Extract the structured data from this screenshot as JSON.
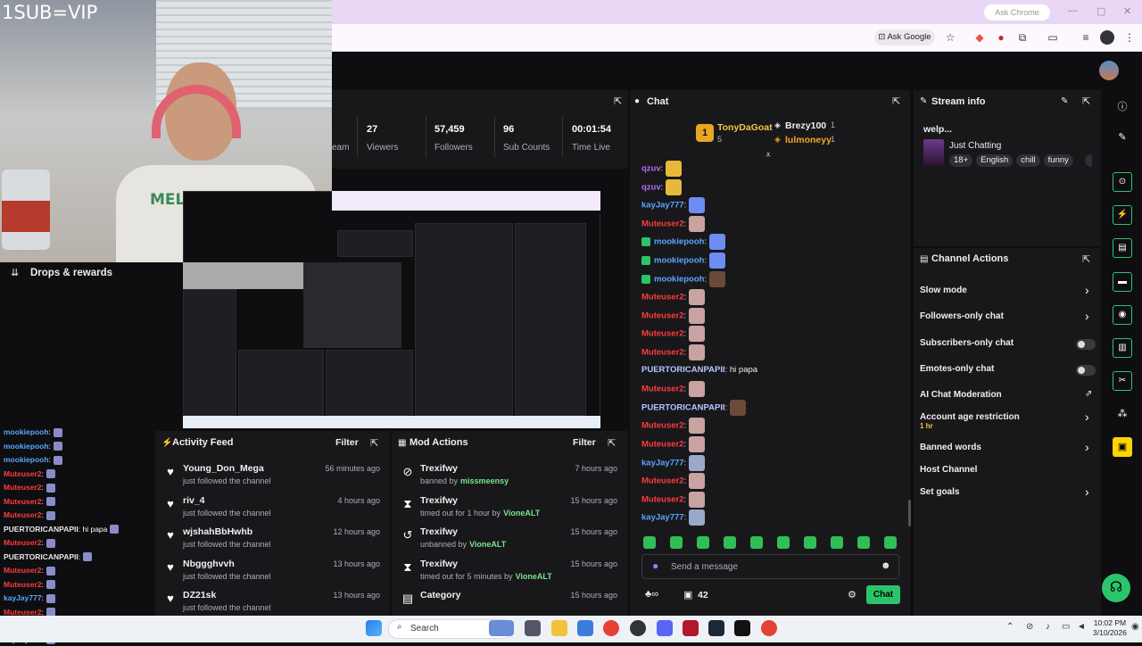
{
  "browser": {
    "ask_chrome": "Ask Chrome",
    "ask_google": "Ask Google",
    "ext_badge": "1"
  },
  "overlay": {
    "sub_vip": "1SUB=VIP",
    "shirt_text": "MELVINS"
  },
  "drops": {
    "title": "Drops & rewards"
  },
  "left_chat": [
    {
      "user": "mookiepooh",
      "color": "#5aa6ff",
      "text": ":"
    },
    {
      "user": "mookiepooh",
      "color": "#5aa6ff",
      "text": ":"
    },
    {
      "user": "mookiepooh",
      "color": "#5aa6ff",
      "text": ":"
    },
    {
      "user": "Muteuser2",
      "color": "#ff3b3b",
      "text": ":"
    },
    {
      "user": "Muteuser2",
      "color": "#ff3b3b",
      "text": ":"
    },
    {
      "user": "Muteuser2",
      "color": "#ff3b3b",
      "text": ":"
    },
    {
      "user": "Muteuser2",
      "color": "#ff3b3b",
      "text": ":"
    },
    {
      "user": "PUERTORICANPAPII",
      "color": "#e6e6e6",
      "text": ": hi papa"
    },
    {
      "user": "Muteuser2",
      "color": "#ff3b3b",
      "text": ":"
    },
    {
      "user": "PUERTORICANPAPII",
      "color": "#e6e6e6",
      "text": ":"
    },
    {
      "user": "Muteuser2",
      "color": "#ff3b3b",
      "text": ":"
    },
    {
      "user": "Muteuser2",
      "color": "#ff3b3b",
      "text": ":"
    },
    {
      "user": "kayJay777",
      "color": "#5aa6ff",
      "text": ":"
    },
    {
      "user": "Muteuser2",
      "color": "#ff3b3b",
      "text": ":"
    },
    {
      "user": "Muteuser2",
      "color": "#ff3b3b",
      "text": ":"
    },
    {
      "user": "kayJay777",
      "color": "#5aa6ff",
      "text": ":"
    }
  ],
  "stats": {
    "team_partial": "eam",
    "items": [
      {
        "value": "27",
        "label": "Viewers"
      },
      {
        "value": "57,459",
        "label": "Followers"
      },
      {
        "value": "96",
        "label": "Sub Counts"
      },
      {
        "value": "00:01:54",
        "label": "Time Live"
      }
    ]
  },
  "activity_feed": {
    "title": "Activity Feed",
    "filter": "Filter",
    "items": [
      {
        "name": "Young_Don_Mega",
        "desc": "just followed the channel",
        "time": "56 minutes ago",
        "icon": "heart-icon"
      },
      {
        "name": "riv_4",
        "desc": "just followed the channel",
        "time": "4 hours ago",
        "icon": "heart-icon"
      },
      {
        "name": "wjshahBbHwhb",
        "desc": "just followed the channel",
        "time": "12 hours ago",
        "icon": "heart-icon"
      },
      {
        "name": "Nbggghvvh",
        "desc": "just followed the channel",
        "time": "13 hours ago",
        "icon": "heart-icon"
      },
      {
        "name": "DZ21sk",
        "desc": "just followed the channel",
        "time": "13 hours ago",
        "icon": "heart-icon"
      }
    ]
  },
  "mod_actions": {
    "title": "Mod Actions",
    "filter": "Filter",
    "items": [
      {
        "name": "Trexifwy",
        "action": "banned by",
        "by": "missmeensy",
        "time": "7 hours ago",
        "icon": "ban-icon"
      },
      {
        "name": "Trexifwy",
        "action": "timed out for 1 hour by",
        "by": "VioneALT",
        "time": "15 hours ago",
        "icon": "hourglass-icon"
      },
      {
        "name": "Trexifwy",
        "action": "unbanned by",
        "by": "VioneALT",
        "time": "15 hours ago",
        "icon": "undo-icon"
      },
      {
        "name": "Trexifwy",
        "action": "timed out for 5 minutes by",
        "by": "VioneALT",
        "time": "15 hours ago",
        "icon": "hourglass-icon"
      },
      {
        "name": "Category",
        "action": "",
        "by": "",
        "time": "15 hours ago",
        "icon": "category-icon"
      }
    ]
  },
  "chat": {
    "title": "Chat",
    "leaderboard": {
      "first": {
        "rank": "1",
        "name": "TonyDaGoat",
        "count": "5"
      },
      "others": [
        {
          "name": "Brezy100",
          "count": "1"
        },
        {
          "name": "lulmoneyy",
          "count": "1"
        }
      ]
    },
    "messages": [
      {
        "user": "qzuv",
        "color": "#b76cf0",
        "text": ":"
      },
      {
        "user": "qzuv",
        "color": "#b76cf0",
        "text": ":"
      },
      {
        "user": "kayJay777",
        "color": "#5aa6ff",
        "text": ":"
      },
      {
        "user": "Muteuser2",
        "color": "#ff3b3b",
        "text": ":"
      },
      {
        "user": "mookiepooh",
        "color": "#5aa6ff",
        "text": ":"
      },
      {
        "user": "mookiepooh",
        "color": "#5aa6ff",
        "text": ":"
      },
      {
        "user": "mookiepooh",
        "color": "#5aa6ff",
        "text": ":"
      },
      {
        "user": "Muteuser2",
        "color": "#ff3b3b",
        "text": ":"
      },
      {
        "user": "Muteuser2",
        "color": "#ff3b3b",
        "text": ":"
      },
      {
        "user": "Muteuser2",
        "color": "#ff3b3b",
        "text": ":"
      },
      {
        "user": "Muteuser2",
        "color": "#ff3b3b",
        "text": ":"
      },
      {
        "user": "PUERTORICANPAPII",
        "color": "#b9c6ff",
        "text": ": hi papa"
      },
      {
        "user": "Muteuser2",
        "color": "#ff3b3b",
        "text": ":"
      },
      {
        "user": "PUERTORICANPAPII",
        "color": "#b9c6ff",
        "text": ":"
      },
      {
        "user": "Muteuser2",
        "color": "#ff3b3b",
        "text": ":"
      },
      {
        "user": "Muteuser2",
        "color": "#ff3b3b",
        "text": ":"
      },
      {
        "user": "kayJay777",
        "color": "#5aa6ff",
        "text": ":"
      },
      {
        "user": "Muteuser2",
        "color": "#ff3b3b",
        "text": ":"
      },
      {
        "user": "Muteuser2",
        "color": "#ff3b3b",
        "text": ":"
      },
      {
        "user": "kayJay777",
        "color": "#5aa6ff",
        "text": ":"
      }
    ],
    "placeholder": "Send a message",
    "points": "42",
    "send_label": "Chat"
  },
  "stream_info": {
    "title": "Stream info",
    "stream_title": "welp...",
    "category": "Just Chatting",
    "tags": [
      "18+",
      "English",
      "chill",
      "funny"
    ]
  },
  "channel_actions": {
    "title": "Channel Actions",
    "items": [
      {
        "label": "Slow mode",
        "control": "chevron"
      },
      {
        "label": "Followers-only chat",
        "control": "chevron"
      },
      {
        "label": "Subscribers-only chat",
        "control": "toggle"
      },
      {
        "label": "Emotes-only chat",
        "control": "toggle"
      },
      {
        "label": "AI Chat Moderation",
        "control": "external"
      },
      {
        "label": "Account age restriction",
        "sub": "1 hr",
        "control": "chevron"
      },
      {
        "label": "Banned words",
        "control": "chevron"
      },
      {
        "label": "Host Channel",
        "control": "none"
      },
      {
        "label": "Set goals",
        "control": "chevron"
      }
    ]
  },
  "taskbar": {
    "search": "Search",
    "time": "10:02 PM",
    "date": "3/10/2026"
  },
  "colors": {
    "accent_green": "#2cc46b",
    "mute_red": "#ff3b3b",
    "twitch_dark": "#18181b"
  }
}
